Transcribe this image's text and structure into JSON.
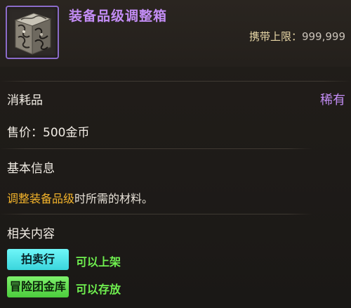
{
  "item": {
    "name": "装备品级调整箱",
    "carry_label": "携带上限：",
    "carry_value": "999,999",
    "icon": "ornate-metal-cube-icon"
  },
  "details": {
    "category": "消耗品",
    "rarity": "稀有",
    "price": "售价：500金币"
  },
  "basic_info": {
    "title": "基本信息",
    "desc_highlight": "调整装备品级",
    "desc_rest": "时所需的材料。"
  },
  "related": {
    "title": "相关内容",
    "auction_badge": "拍卖行",
    "auction_note": "可以上架",
    "bank_badge": "冒险团金库",
    "bank_note": "可以存放"
  },
  "colors": {
    "rarity_purple": "#c38df5",
    "highlight_orange": "#f3b32b",
    "auction_cyan": "#3ad5dc",
    "bank_green": "#4ccd3d",
    "note_green": "#6fef4f"
  }
}
